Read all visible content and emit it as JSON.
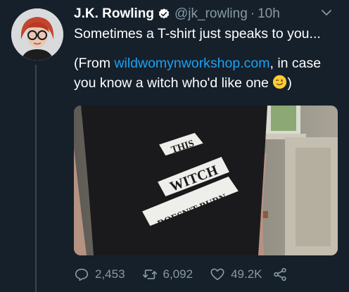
{
  "tweet": {
    "author_name": "J.K. Rowling",
    "handle": "@jk_rowling",
    "separator": "·",
    "time": "10h",
    "text_line1": "Sometimes a T-shirt just speaks to you...",
    "text_line2_prefix": "(From ",
    "link": "wildwomynworkshop.com",
    "text_line2_suffix": ", in case",
    "text_line3": "you know a witch who'd like one",
    "text_line3_end": ")"
  },
  "media": {
    "shirt_text": [
      "THIS",
      "WITCH",
      "DOESN'T BURN"
    ]
  },
  "actions": {
    "replies": "2,453",
    "retweets": "6,092",
    "likes": "49.2K"
  },
  "icons": {
    "verified": "verified-badge-icon",
    "more": "chevron-down-icon",
    "reply": "reply-icon",
    "retweet": "retweet-icon",
    "like": "heart-icon",
    "share": "share-icon",
    "emoji": "winking-face-icon"
  },
  "colors": {
    "background": "#15202b",
    "text": "#ffffff",
    "secondary": "#8899a6",
    "link": "#1da1f2"
  }
}
